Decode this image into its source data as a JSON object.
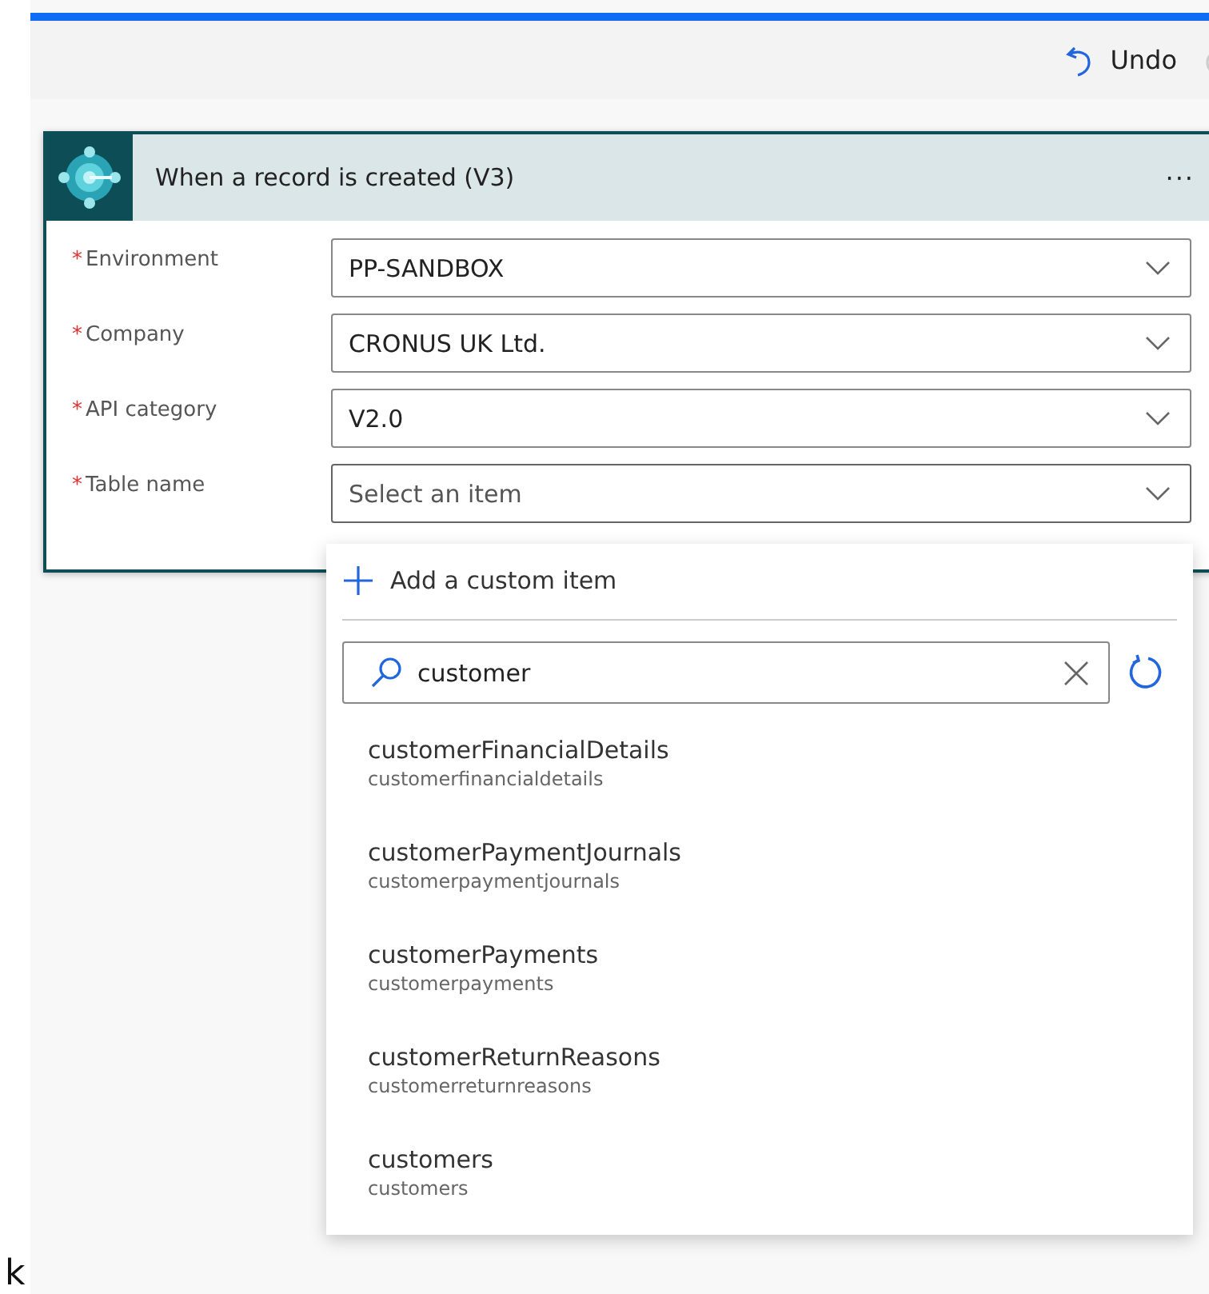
{
  "toolbar": {
    "undo": {
      "label": "Undo",
      "disabled": false
    },
    "redo": {
      "disabled": true
    }
  },
  "card": {
    "title": "When a record is created (V3)",
    "more": "···",
    "fields": [
      {
        "label": "Environment",
        "required_mark": "*",
        "value": "PP-SANDBOX",
        "placeholder": false
      },
      {
        "label": "Company",
        "required_mark": "*",
        "value": "CRONUS UK Ltd.",
        "placeholder": false
      },
      {
        "label": "API category",
        "required_mark": "*",
        "value": "V2.0",
        "placeholder": false
      },
      {
        "label": "Table name",
        "required_mark": "*",
        "value": "Select an item",
        "placeholder": true,
        "expanded": true
      }
    ]
  },
  "dropdown": {
    "add_custom": "Add a custom item",
    "search": {
      "value": "customer"
    },
    "items": [
      {
        "title": "customerFinancialDetails",
        "subtitle": "customerfinancialdetails"
      },
      {
        "title": "customerPaymentJournals",
        "subtitle": "customerpaymentjournals"
      },
      {
        "title": "customerPayments",
        "subtitle": "customerpayments"
      },
      {
        "title": "customerReturnReasons",
        "subtitle": "customerreturnreasons"
      },
      {
        "title": "customers",
        "subtitle": "customers"
      }
    ]
  },
  "edge_fragment": "k"
}
